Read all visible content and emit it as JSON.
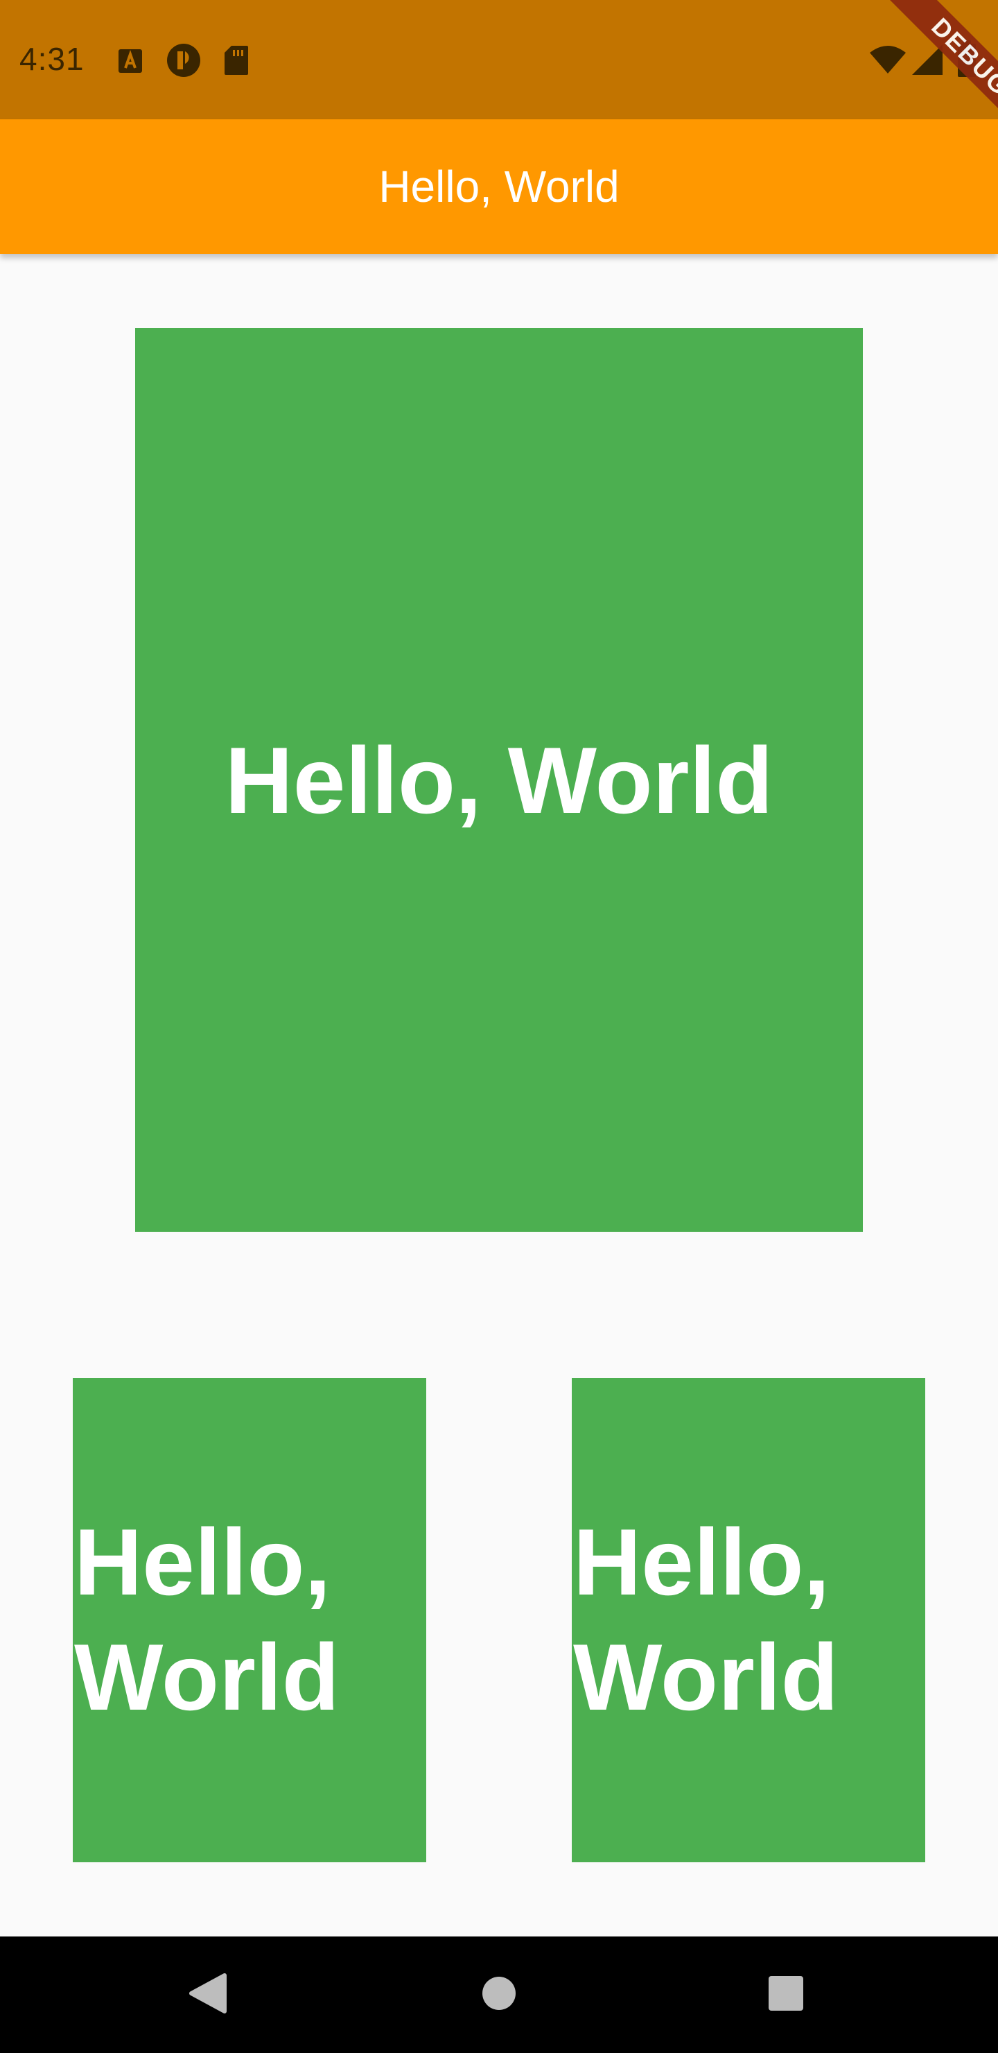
{
  "status_bar": {
    "time": "4:31",
    "icons": [
      "text-a-icon",
      "app-icon",
      "sd-card-icon",
      "wifi-icon",
      "signal-icon",
      "battery-icon"
    ]
  },
  "debug_banner": {
    "label": "DEBUG"
  },
  "app_bar": {
    "title": "Hello, World",
    "color": "#ff9800"
  },
  "boxes": {
    "large": {
      "text": "Hello, World"
    },
    "small_left": {
      "text": "Hello, World"
    },
    "small_right": {
      "text": "Hello, World"
    },
    "color": "#4caf50"
  },
  "nav_bar": {
    "buttons": [
      "back-icon",
      "home-icon",
      "recents-icon"
    ]
  }
}
